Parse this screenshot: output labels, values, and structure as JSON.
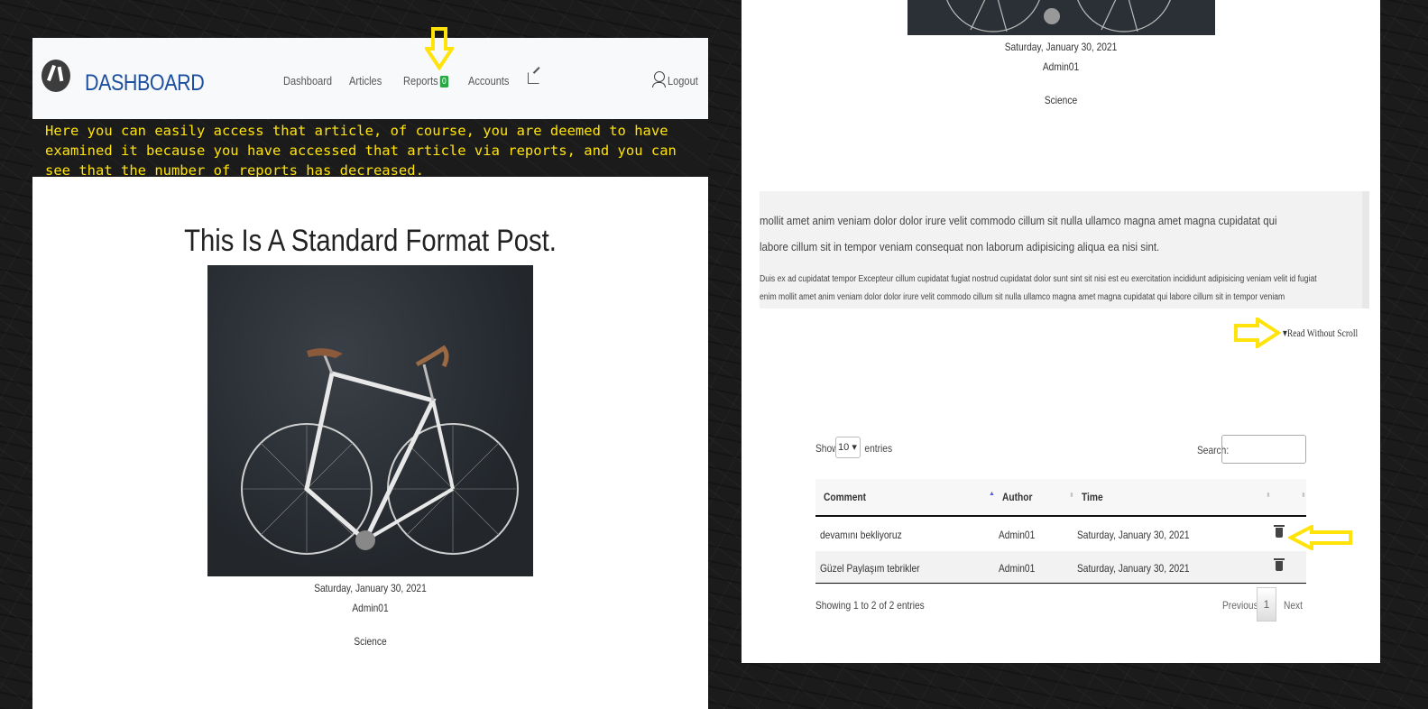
{
  "nav": {
    "brand": "DASHBOARD",
    "links": [
      "Dashboard",
      "Articles",
      "Reports",
      "Accounts"
    ],
    "reports_badge": "0",
    "logout": "Logout"
  },
  "caption": "Here you can easily access that article, of course, you are deemed to have examined it because you have accessed that article via reports, and you can see that the number of reports has decreased.",
  "post": {
    "title": "This Is A Standard Format Post.",
    "date": "Saturday, January 30, 2021",
    "author": "Admin01",
    "category": "Science"
  },
  "scroll": {
    "para1": "mollit amet anim veniam dolor dolor irure velit commodo cillum sit nulla ullamco magna amet magna cupidatat qui labore cillum sit in tempor veniam consequat non laborum adipisicing aliqua ea nisi sint.",
    "para2": "Duis ex ad cupidatat tempor Excepteur cillum cupidatat fugiat nostrud cupidatat dolor sunt sint sit nisi est eu exercitation incididunt adipisicing veniam velit id fugiat enim mollit amet anim veniam dolor dolor irure velit commodo cillum sit nulla ullamco magna amet magna cupidatat qui labore cillum sit in tempor veniam consequat non laborum adipisicing aliqua ea nisi sint et quis proident.",
    "read_link": "▾Read Without Scroll"
  },
  "table": {
    "show": "Show",
    "entries_value": "10",
    "entries": "entries",
    "search": "Search:",
    "headers": [
      "Comment",
      "Author",
      "Time"
    ],
    "rows": [
      {
        "comment": "devamını bekliyoruz",
        "author": "Admin01",
        "time": "Saturday, January 30, 2021"
      },
      {
        "comment": "Güzel Paylaşım tebrikler",
        "author": "Admin01",
        "time": "Saturday, January 30, 2021"
      }
    ],
    "info": "Showing 1 to 2 of 2 entries",
    "previous": "Previous",
    "page": "1",
    "next": "Next"
  },
  "colors": {
    "annotation": "#ffe30a",
    "brand": "#1d4fa0",
    "badge": "#28a745"
  }
}
